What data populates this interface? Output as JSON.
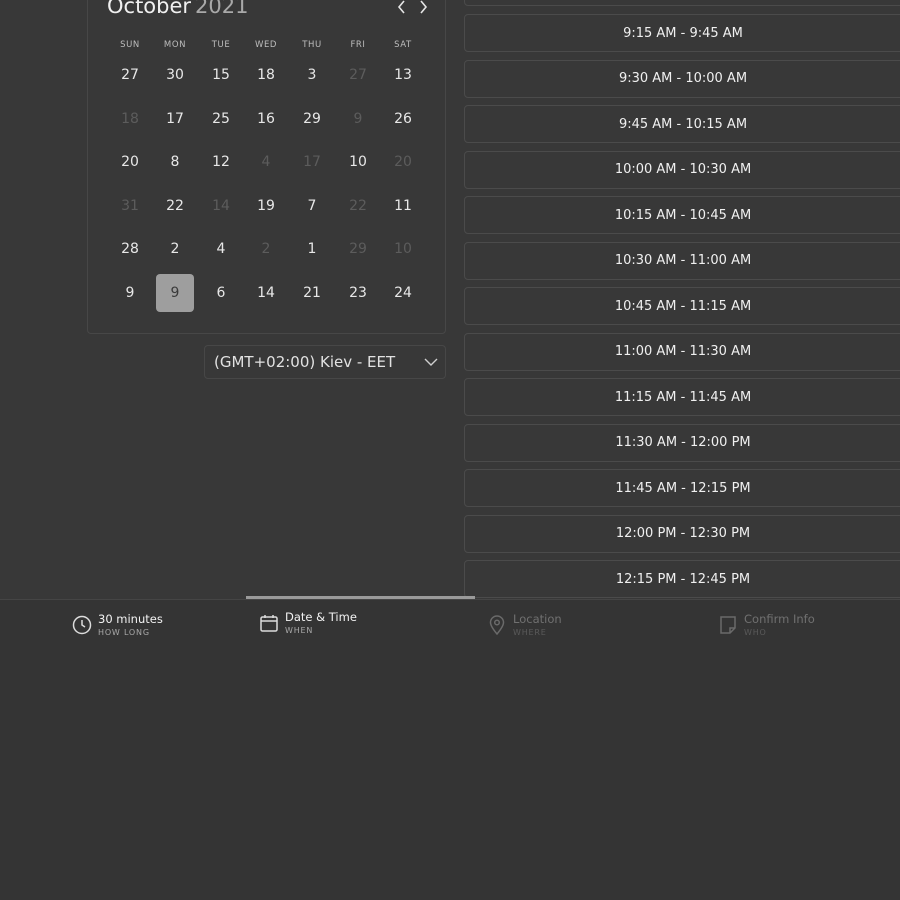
{
  "calendar": {
    "month": "October",
    "year": "2021",
    "prev_icon": "chevron-left-icon",
    "next_icon": "chevron-right-icon",
    "weekdays": [
      "SUN",
      "MON",
      "TUE",
      "WED",
      "THU",
      "FRI",
      "SAT"
    ],
    "weeks": [
      [
        {
          "d": "27",
          "m": false
        },
        {
          "d": "30",
          "m": false
        },
        {
          "d": "15",
          "m": false
        },
        {
          "d": "18",
          "m": false
        },
        {
          "d": "3",
          "m": false
        },
        {
          "d": "27",
          "m": true
        },
        {
          "d": "13",
          "m": false
        }
      ],
      [
        {
          "d": "18",
          "m": true
        },
        {
          "d": "17",
          "m": false
        },
        {
          "d": "25",
          "m": false
        },
        {
          "d": "16",
          "m": false
        },
        {
          "d": "29",
          "m": false
        },
        {
          "d": "9",
          "m": true
        },
        {
          "d": "26",
          "m": false
        }
      ],
      [
        {
          "d": "20",
          "m": false
        },
        {
          "d": "8",
          "m": false
        },
        {
          "d": "12",
          "m": false
        },
        {
          "d": "4",
          "m": true
        },
        {
          "d": "17",
          "m": true
        },
        {
          "d": "10",
          "m": false
        },
        {
          "d": "20",
          "m": true
        }
      ],
      [
        {
          "d": "31",
          "m": true
        },
        {
          "d": "22",
          "m": false
        },
        {
          "d": "14",
          "m": true
        },
        {
          "d": "19",
          "m": false
        },
        {
          "d": "7",
          "m": false
        },
        {
          "d": "22",
          "m": true
        },
        {
          "d": "11",
          "m": false
        }
      ],
      [
        {
          "d": "28",
          "m": false
        },
        {
          "d": "2",
          "m": false
        },
        {
          "d": "4",
          "m": false
        },
        {
          "d": "2",
          "m": true
        },
        {
          "d": "1",
          "m": false
        },
        {
          "d": "29",
          "m": true
        },
        {
          "d": "10",
          "m": true
        }
      ],
      [
        {
          "d": "9",
          "m": false
        },
        {
          "d": "9",
          "m": false,
          "s": true
        },
        {
          "d": "6",
          "m": false
        },
        {
          "d": "14",
          "m": false
        },
        {
          "d": "21",
          "m": false
        },
        {
          "d": "23",
          "m": false
        },
        {
          "d": "24",
          "m": false
        }
      ]
    ]
  },
  "timezone": {
    "label": "(GMT+02:00) Kiev - EET",
    "icon": "chevron-down-icon"
  },
  "slots": [
    "9:15 AM - 9:45 AM",
    "9:30 AM - 10:00 AM",
    "9:45 AM - 10:15 AM",
    "10:00 AM - 10:30 AM",
    "10:15 AM - 10:45 AM",
    "10:30 AM - 11:00 AM",
    "10:45 AM - 11:15 AM",
    "11:00 AM - 11:30 AM",
    "11:15 AM - 11:45 AM",
    "11:30 AM - 12:00 PM",
    "11:45 AM - 12:15 PM",
    "12:00 PM - 12:30 PM",
    "12:15 PM - 12:45 PM"
  ],
  "steps": [
    {
      "title": "30 minutes",
      "sub": "HOW LONG",
      "icon": "clock-icon",
      "state": "done"
    },
    {
      "title": "Date & Time",
      "sub": "WHEN",
      "icon": "calendar-icon",
      "state": "active"
    },
    {
      "title": "Location",
      "sub": "WHERE",
      "icon": "map-pin-icon",
      "state": "upcoming"
    },
    {
      "title": "Confirm Info",
      "sub": "WHO",
      "icon": "note-icon",
      "state": "upcoming"
    }
  ],
  "colors": {
    "background": "#383838",
    "selected_day": "#9e9e9e",
    "muted_text": "#5c5c5c",
    "active_indicator": "#9a9a9a"
  }
}
